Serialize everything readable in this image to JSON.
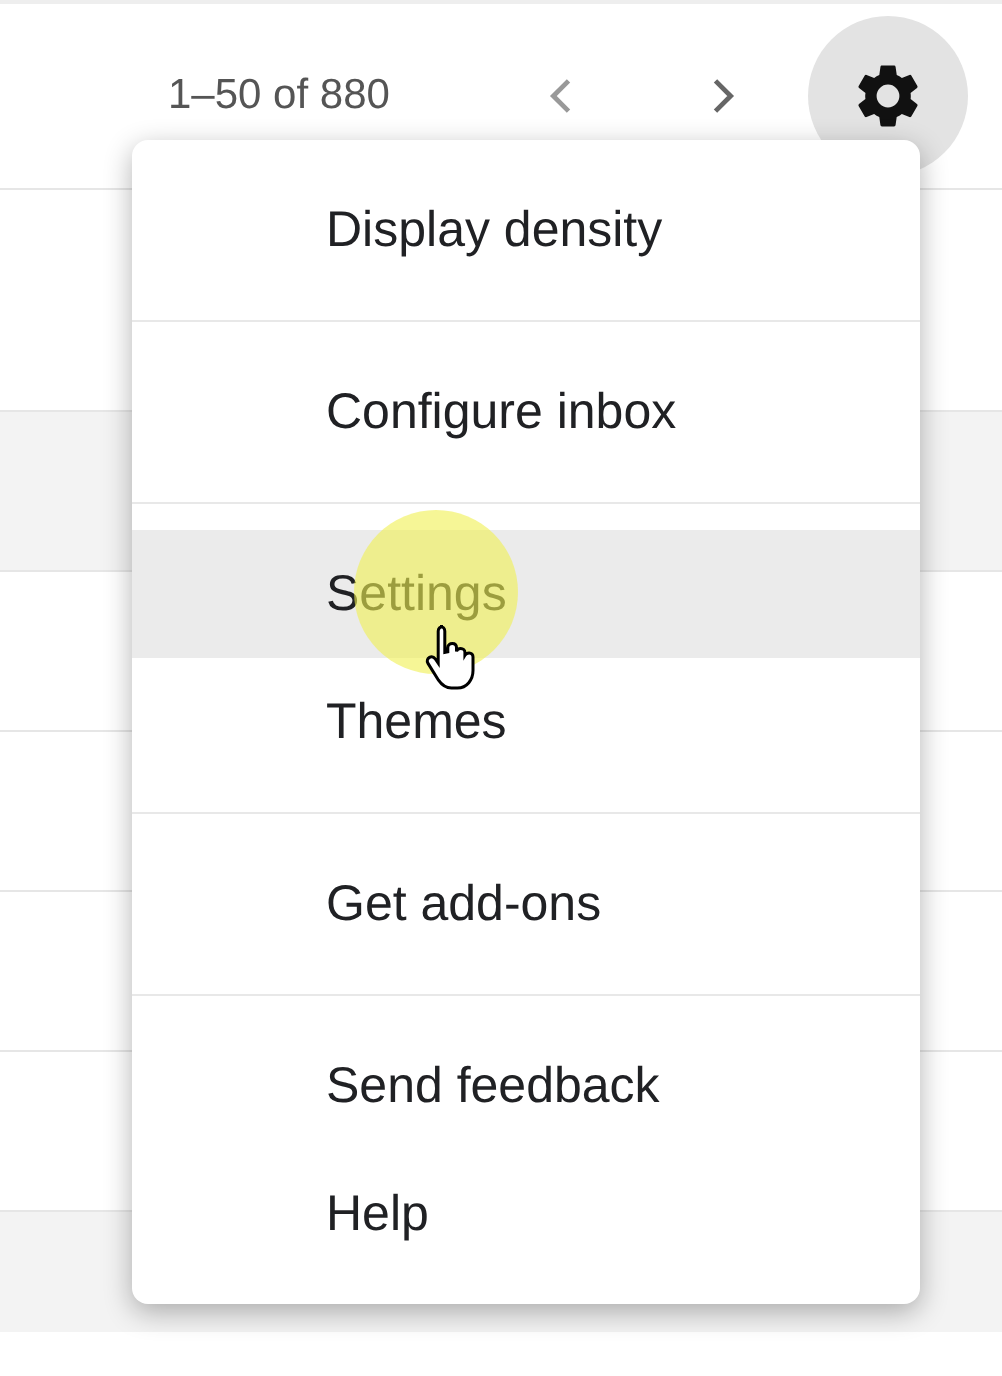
{
  "pager": {
    "range": "1–50 of 880"
  },
  "menu": {
    "groups": [
      {
        "items": [
          {
            "label": "Display density",
            "selected": false
          }
        ]
      },
      {
        "items": [
          {
            "label": "Configure inbox",
            "selected": false
          }
        ]
      },
      {
        "items": [
          {
            "label": "Settings",
            "selected": true
          },
          {
            "label": "Themes",
            "selected": false
          }
        ]
      },
      {
        "items": [
          {
            "label": "Get add-ons",
            "selected": false
          }
        ]
      },
      {
        "items": [
          {
            "label": "Send feedback",
            "selected": false
          },
          {
            "label": "Help",
            "selected": false
          }
        ]
      }
    ]
  }
}
